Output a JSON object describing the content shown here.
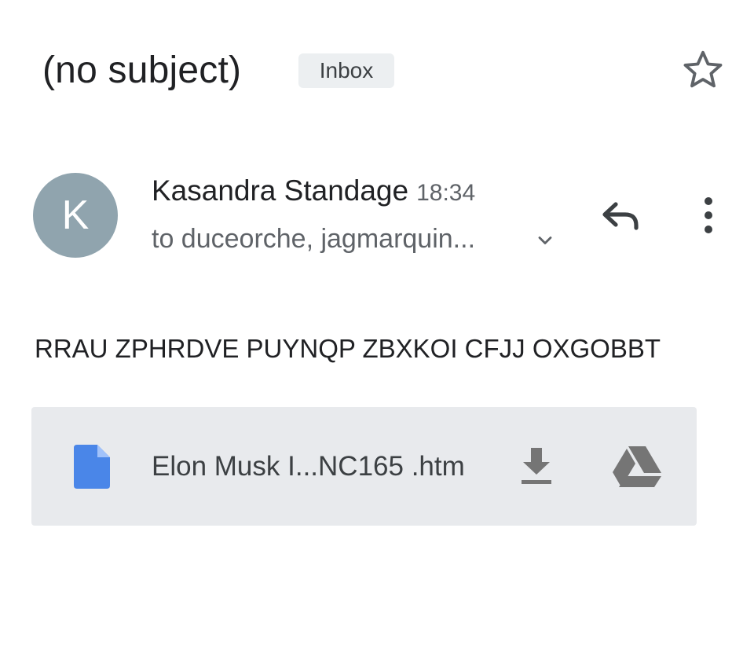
{
  "header": {
    "subject": "(no subject)",
    "label": "Inbox",
    "star_icon": "star-outline-icon"
  },
  "message": {
    "avatar_letter": "K",
    "avatar_color": "#90a4ae",
    "sender_name": "Kasandra Standage",
    "time": "18:34",
    "recipients": "to duceorche, jagmarquin...",
    "expand_icon": "chevron-down-icon",
    "reply_icon": "reply-icon",
    "more_icon": "more-vert-icon",
    "body": "RRAU ZPHRDVE PUYNQP ZBXKOI CFJJ OXGOBBT"
  },
  "attachment": {
    "file_icon": "document-icon",
    "file_icon_color": "#4a86e8",
    "file_name": "Elon Musk I...NC165 .htm",
    "download_icon": "download-icon",
    "drive_icon": "google-drive-icon",
    "background": "#e8eaed"
  }
}
